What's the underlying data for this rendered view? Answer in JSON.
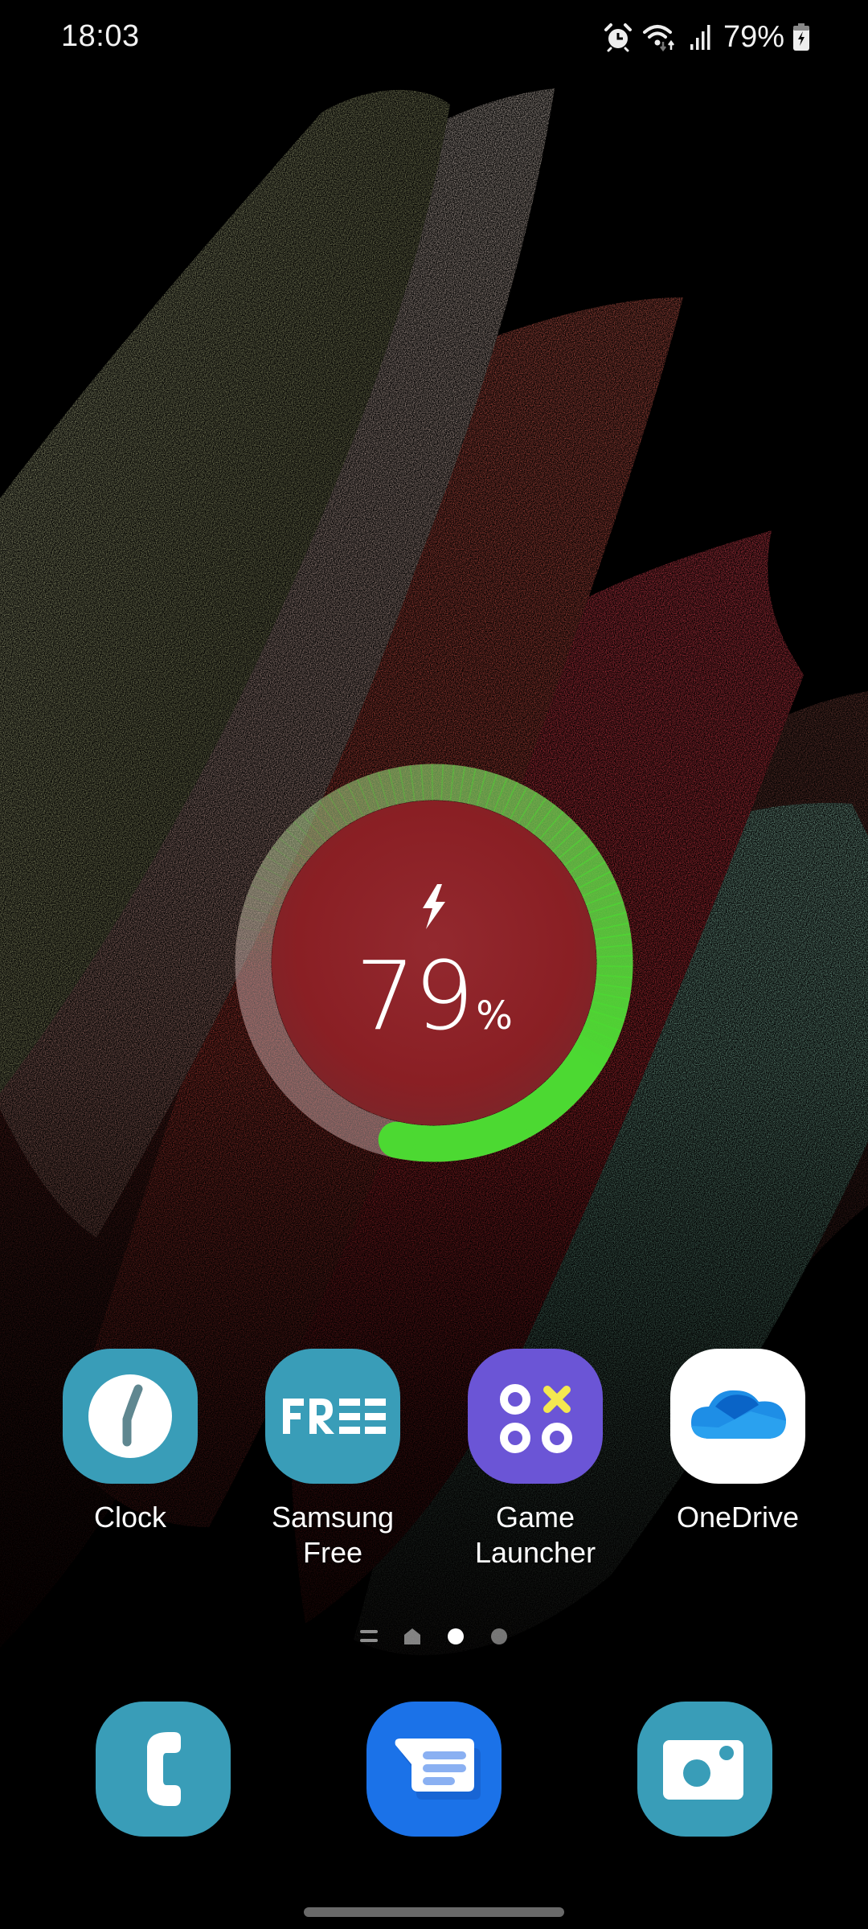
{
  "status_bar": {
    "time": "18:03",
    "icons": [
      "alarm-icon",
      "wifi-icon",
      "signal-icon",
      "battery-charging-icon"
    ],
    "battery_text": "79%"
  },
  "battery_widget": {
    "level_percent": 79,
    "value_text": "79",
    "unit": "%",
    "charging": true,
    "icon": "lightning-bolt-icon",
    "arc_color": "#4cd932",
    "disc_color": "#8a2a2e"
  },
  "apps": [
    {
      "name": "clock",
      "label": "Clock",
      "icon": "clock-icon",
      "bg": "#399db8"
    },
    {
      "name": "samsung-free",
      "label": "Samsung Free",
      "icon": "free-logo-icon",
      "bg": "#399db8"
    },
    {
      "name": "game-launcher",
      "label": "Game Launcher",
      "icon": "tic-tac-toe-icon",
      "bg": "#6b55d6"
    },
    {
      "name": "onedrive",
      "label": "OneDrive",
      "icon": "cloud-icon",
      "bg": "#ffffff"
    }
  ],
  "page_indicator": {
    "pages": [
      "menu",
      "home",
      "dot",
      "dot"
    ],
    "active_index": 2
  },
  "dock": [
    {
      "name": "phone",
      "icon": "phone-icon",
      "bg": "#399db8"
    },
    {
      "name": "messages",
      "icon": "message-icon",
      "bg": "#1b72e8"
    },
    {
      "name": "camera",
      "icon": "camera-icon",
      "bg": "#399db8"
    }
  ],
  "colors": {
    "icon_teal": "#399db8",
    "game_purple": "#6b55d6",
    "messages_blue": "#1b72e8",
    "battery_green": "#4cd932"
  }
}
